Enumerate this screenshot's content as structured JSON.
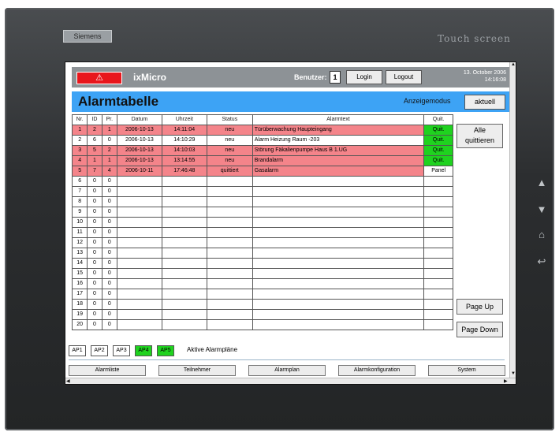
{
  "device": {
    "brand_left": "Siemens",
    "brand_right": "Touch screen",
    "side_buttons": [
      "arrow-up",
      "arrow-down",
      "home",
      "back"
    ]
  },
  "header": {
    "alarm_icon": "⚠",
    "app_name": "ixMicro",
    "user_label": "Benutzer:",
    "user_value": "1",
    "login_label": "Login",
    "logout_label": "Logout",
    "date": "13. October 2006",
    "time": "14:16:08",
    "colors": {
      "header_bg": "#8d9296",
      "alarm_red": "#e8161c"
    }
  },
  "titlebar": {
    "title": "Alarmtabelle",
    "mode_label": "Anzeigemodus",
    "mode_button": "aktuell",
    "bg": "#3da3f5"
  },
  "table": {
    "columns": [
      "Nr.",
      "ID",
      "Pr.",
      "Datum",
      "Uhrzeit",
      "Status",
      "Alarmtext",
      "Quit."
    ],
    "rows": [
      {
        "nr": "1",
        "id": "2",
        "pr": "1",
        "datum": "2006-10-13",
        "uhrzeit": "14:11:04",
        "status": "neu",
        "text": "Türüberwachung Haupteingang",
        "quit": "Quit.",
        "highlight": true,
        "quit_green": true
      },
      {
        "nr": "2",
        "id": "6",
        "pr": "0",
        "datum": "2006-10-13",
        "uhrzeit": "14:10:29",
        "status": "neu",
        "text": "Alarm Heizung Raum -203",
        "quit": "Quit.",
        "highlight": false,
        "quit_green": true
      },
      {
        "nr": "3",
        "id": "5",
        "pr": "2",
        "datum": "2006-10-13",
        "uhrzeit": "14:10:03",
        "status": "neu",
        "text": "Störung Fäkalienpumpe Haus B  1.UG",
        "quit": "Quit.",
        "highlight": true,
        "quit_green": true
      },
      {
        "nr": "4",
        "id": "1",
        "pr": "1",
        "datum": "2006-10-13",
        "uhrzeit": "13:14:55",
        "status": "neu",
        "text": "Brandalarm",
        "quit": "Quit.",
        "highlight": true,
        "quit_green": true
      },
      {
        "nr": "5",
        "id": "7",
        "pr": "4",
        "datum": "2006-10-11",
        "uhrzeit": "17:46:48",
        "status": "quittiert",
        "text": "Gasalarm",
        "quit": "Panel",
        "highlight": true,
        "quit_green": false
      },
      {
        "nr": "6",
        "id": "0",
        "pr": "0"
      },
      {
        "nr": "7",
        "id": "0",
        "pr": "0"
      },
      {
        "nr": "8",
        "id": "0",
        "pr": "0"
      },
      {
        "nr": "9",
        "id": "0",
        "pr": "0"
      },
      {
        "nr": "10",
        "id": "0",
        "pr": "0"
      },
      {
        "nr": "11",
        "id": "0",
        "pr": "0"
      },
      {
        "nr": "12",
        "id": "0",
        "pr": "0"
      },
      {
        "nr": "13",
        "id": "0",
        "pr": "0"
      },
      {
        "nr": "14",
        "id": "0",
        "pr": "0"
      },
      {
        "nr": "15",
        "id": "0",
        "pr": "0"
      },
      {
        "nr": "16",
        "id": "0",
        "pr": "0"
      },
      {
        "nr": "17",
        "id": "0",
        "pr": "0"
      },
      {
        "nr": "18",
        "id": "0",
        "pr": "0"
      },
      {
        "nr": "19",
        "id": "0",
        "pr": "0"
      },
      {
        "nr": "20",
        "id": "0",
        "pr": "0"
      }
    ],
    "highlight_color": "#f4848a",
    "quit_color": "#1fd21f"
  },
  "side": {
    "ack_all": [
      "Alle",
      "quittieren"
    ],
    "page_up": "Page Up",
    "page_down": "Page Down"
  },
  "alarm_plans": {
    "items": [
      {
        "label": "AP1",
        "active": false
      },
      {
        "label": "AP2",
        "active": false
      },
      {
        "label": "AP3",
        "active": false
      },
      {
        "label": "AP4",
        "active": true
      },
      {
        "label": "AP5",
        "active": true
      }
    ],
    "label": "Aktive Alarmpläne"
  },
  "nav": [
    "Alarmliste",
    "Teilnehmer",
    "Alarmplan",
    "Alarmkonfiguration",
    "System"
  ]
}
